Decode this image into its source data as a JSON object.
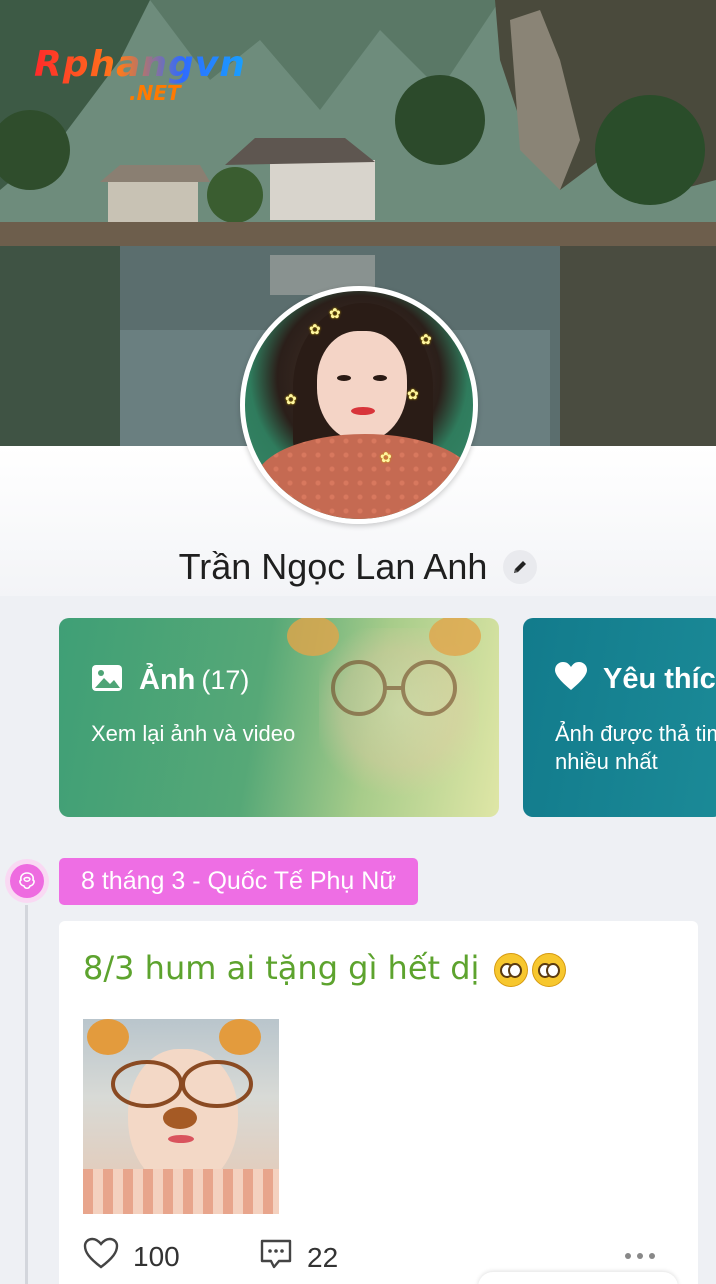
{
  "watermark": {
    "main": "Rphangvn",
    "sub": ".NET"
  },
  "profile": {
    "name": "Trần Ngọc Lan Anh"
  },
  "cards": {
    "photos": {
      "title": "Ảnh",
      "count": "(17)",
      "subtitle": "Xem lại ảnh và video"
    },
    "likes": {
      "title": "Yêu thích",
      "subtitle": "Ảnh được thả tim nhiều nhất"
    }
  },
  "timeline": {
    "event_tag": "8 tháng 3 - Quốc Tế Phụ Nữ",
    "post": {
      "text": "8/3 hum ai tặng gì hết dị",
      "likes": "100",
      "comments": "22"
    }
  },
  "colors": {
    "photos_card": "#3f9f76",
    "likes_card": "#127b8c",
    "event_tag": "#ee6ee4",
    "post_text": "#5da32e"
  },
  "icons": [
    "image-icon",
    "heart-icon",
    "edit-pencil-icon",
    "rose-icon",
    "like-heart-icon",
    "comment-icon",
    "more-dots-icon"
  ]
}
